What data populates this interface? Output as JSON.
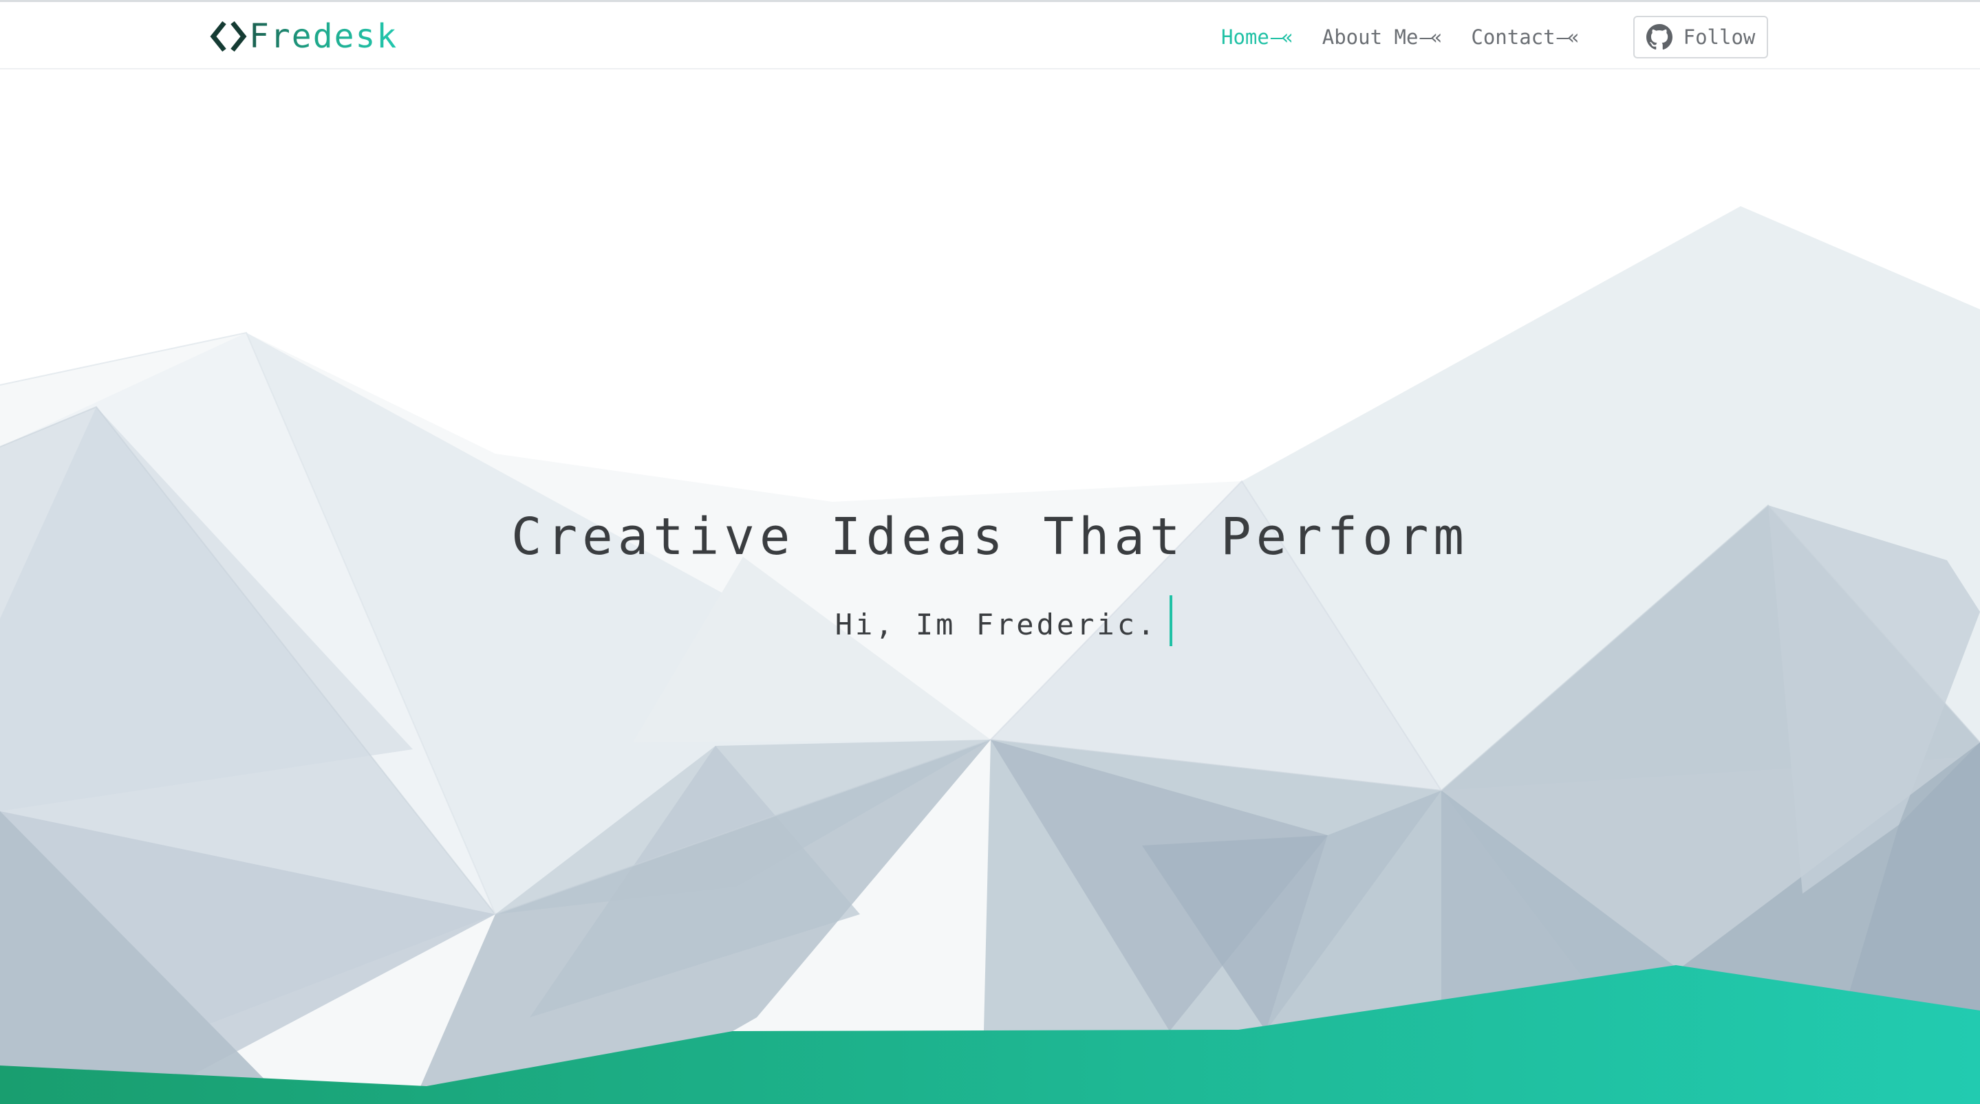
{
  "brand": {
    "name": "Fredesk",
    "icon": "code-brackets-icon",
    "colors": [
      "#1b5e4e",
      "#1fa88b",
      "#22c7ae"
    ]
  },
  "nav": {
    "items": [
      {
        "label": "Home",
        "arrow": "—«",
        "active": true
      },
      {
        "label": "About Me",
        "arrow": "—«",
        "active": false
      },
      {
        "label": "Contact",
        "arrow": "—«",
        "active": false
      }
    ],
    "follow_label": "Follow",
    "follow_icon": "github-icon"
  },
  "hero": {
    "title": "Creative Ideas That Perform",
    "subtitle": "Hi, Im Frederic."
  },
  "colors": {
    "accent": "#20c1a5",
    "text": "#3a3d40",
    "nav_text": "#6a6e73",
    "ground_start": "#199e6f",
    "ground_end": "#22cbb0"
  }
}
